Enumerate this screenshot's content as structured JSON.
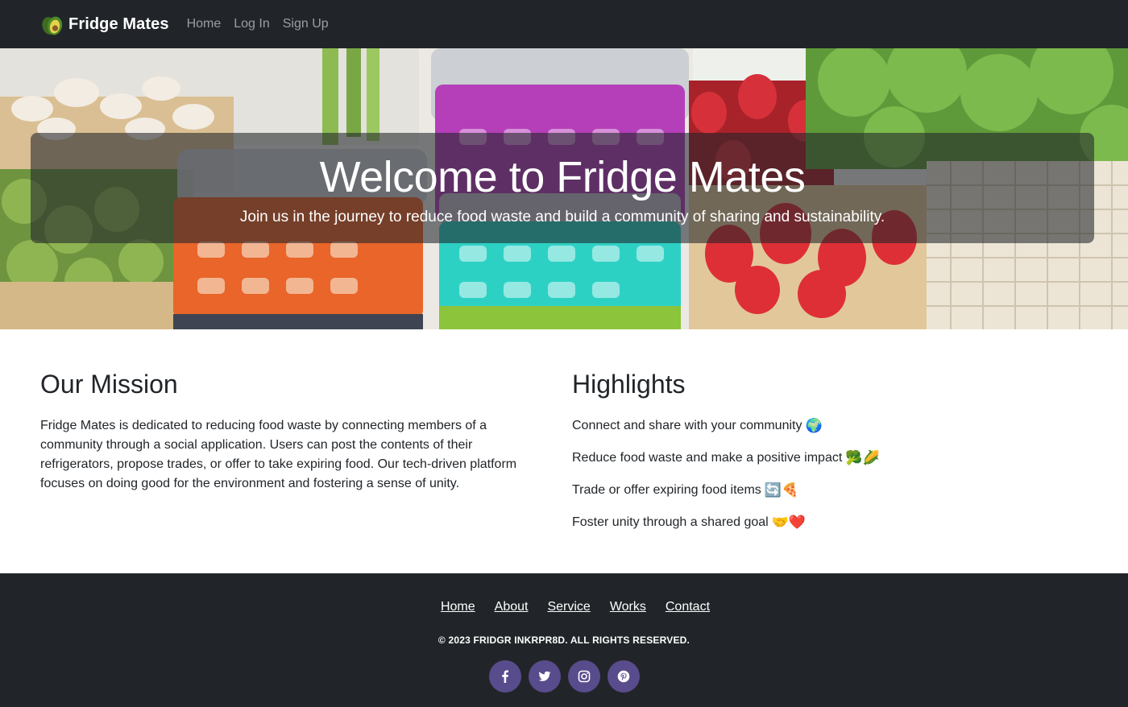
{
  "navbar": {
    "brand": "Fridge Mates",
    "links": [
      "Home",
      "Log In",
      "Sign Up"
    ]
  },
  "hero": {
    "title": "Welcome to Fridge Mates",
    "subtitle": "Join us in the journey to reduce food waste and build a community of sharing and sustainability."
  },
  "mission": {
    "title": "Our Mission",
    "text": "Fridge Mates is dedicated to reducing food waste by connecting members of a community through a social application. Users can post the contents of their refrigerators, propose trades, or offer to take expiring food. Our tech-driven platform focuses on doing good for the environment and fostering a sense of unity."
  },
  "highlights": {
    "title": "Highlights",
    "items": [
      {
        "text": "Connect and share with your community",
        "emoji": "🌍"
      },
      {
        "text": "Reduce food waste and make a positive impact",
        "emoji": "🥦🌽"
      },
      {
        "text": "Trade or offer expiring food items",
        "emoji": "🔄🍕"
      },
      {
        "text": "Foster unity through a shared goal",
        "emoji": "🤝❤️"
      }
    ]
  },
  "footer": {
    "links": [
      "Home",
      "About",
      "Service",
      "Works",
      "Contact"
    ],
    "copyright": "© 2023 FRIDGR INKRPR8D. ALL RIGHTS RESERVED.",
    "socials": [
      "facebook-icon",
      "twitter-icon",
      "instagram-icon",
      "pinterest-icon"
    ]
  },
  "colors": {
    "navbar_bg": "#212529",
    "footer_bg": "#212529",
    "social_bg": "#594c8c",
    "hero_overlay": "rgba(33,37,41,0.58)"
  }
}
